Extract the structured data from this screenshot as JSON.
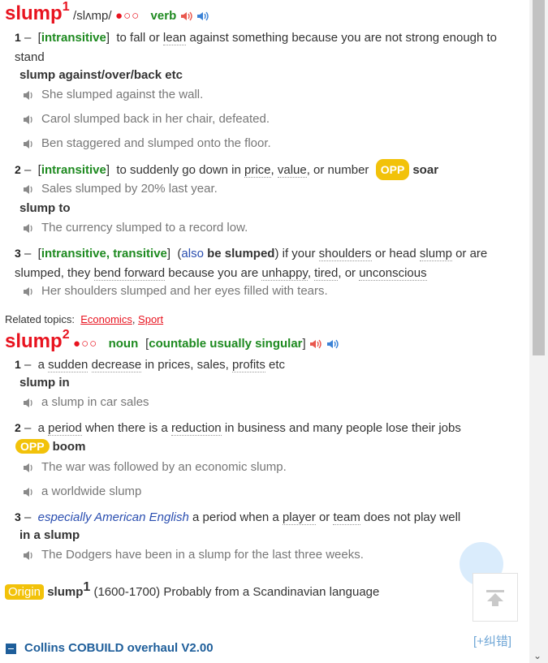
{
  "entry1": {
    "headword": "slump",
    "superscript": "1",
    "pron": "/slʌmp/",
    "freq": "●○○",
    "pos": "verb",
    "senses": [
      {
        "num": "1",
        "dash": "–",
        "gram": "intransitive",
        "def_parts": [
          "to fall or ",
          "lean",
          " against something because you are not strong enough to stand"
        ],
        "collocation": "slump against/over/back etc",
        "examples": [
          "She slumped against the wall.",
          "Carol slumped back in her chair, defeated.",
          "Ben staggered and slumped onto the floor."
        ]
      },
      {
        "num": "2",
        "dash": "–",
        "gram": "intransitive",
        "def_parts": [
          "to suddenly go down in ",
          "price",
          ", ",
          "value",
          ", or number"
        ],
        "opp_label": "OPP",
        "opp_word": "soar",
        "examples": [
          "Sales slumped by 20% last year."
        ],
        "collocation": "slump to",
        "examples2": [
          "The currency slumped to a record low."
        ]
      },
      {
        "num": "3",
        "dash": "–",
        "gram": "intransitive, transitive",
        "also": "also",
        "also_bold": "be slumped",
        "def_parts": [
          ") if your ",
          "shoulders",
          " or head ",
          "slump",
          " or are slumped, they ",
          "bend forward",
          " because you are ",
          "unhappy",
          ", ",
          "tired",
          ", or ",
          "unconscious"
        ],
        "examples": [
          "Her shoulders slumped and her eyes filled with tears."
        ]
      }
    ]
  },
  "related": {
    "label": "Related topics:",
    "topics": [
      "Economics",
      "Sport"
    ]
  },
  "entry2": {
    "headword": "slump",
    "superscript": "2",
    "freq": "●○○",
    "pos": "noun",
    "gram": "countable usually singular",
    "senses": [
      {
        "num": "1",
        "dash": "–",
        "def_parts": [
          "a ",
          "sudden",
          " ",
          "decrease",
          " in prices, sales, ",
          "profits",
          " etc"
        ],
        "collocation": "slump in",
        "examples": [
          "a slump in car sales"
        ]
      },
      {
        "num": "2",
        "dash": "–",
        "def_parts": [
          "a ",
          "period",
          " when there is a ",
          "reduction",
          " in business and many people lose their jobs"
        ],
        "opp_label": "OPP",
        "opp_word": "boom",
        "examples": [
          "The war was followed by an economic slump.",
          "a worldwide slump"
        ]
      },
      {
        "num": "3",
        "dash": "–",
        "register": "especially American English",
        "def_parts": [
          " a period when a ",
          "player",
          " or ",
          "team",
          " does not play well"
        ],
        "collocation": "in a slump",
        "examples": [
          "The Dodgers have been in a slump for the last three weeks."
        ]
      }
    ]
  },
  "origin": {
    "label": "Origin",
    "headword": "slump",
    "superscript": "1",
    "text": "(1600-1700) Probably from a Scandinavian language"
  },
  "footer": {
    "fix_link": "[+纠错]",
    "section_title": "Collins COBUILD overhaul V2.00"
  },
  "icons": {
    "speaker_uk": "speaker-red-icon",
    "speaker_us": "speaker-blue-icon",
    "example_speaker": "example-speaker-icon",
    "scroll_top": "arrow-up-icon",
    "collapse": "minus-icon"
  },
  "colors": {
    "headword": "#e8131f",
    "pos": "#1e8a20",
    "opp": "#f2c20a",
    "link": "#1e5e9a"
  }
}
